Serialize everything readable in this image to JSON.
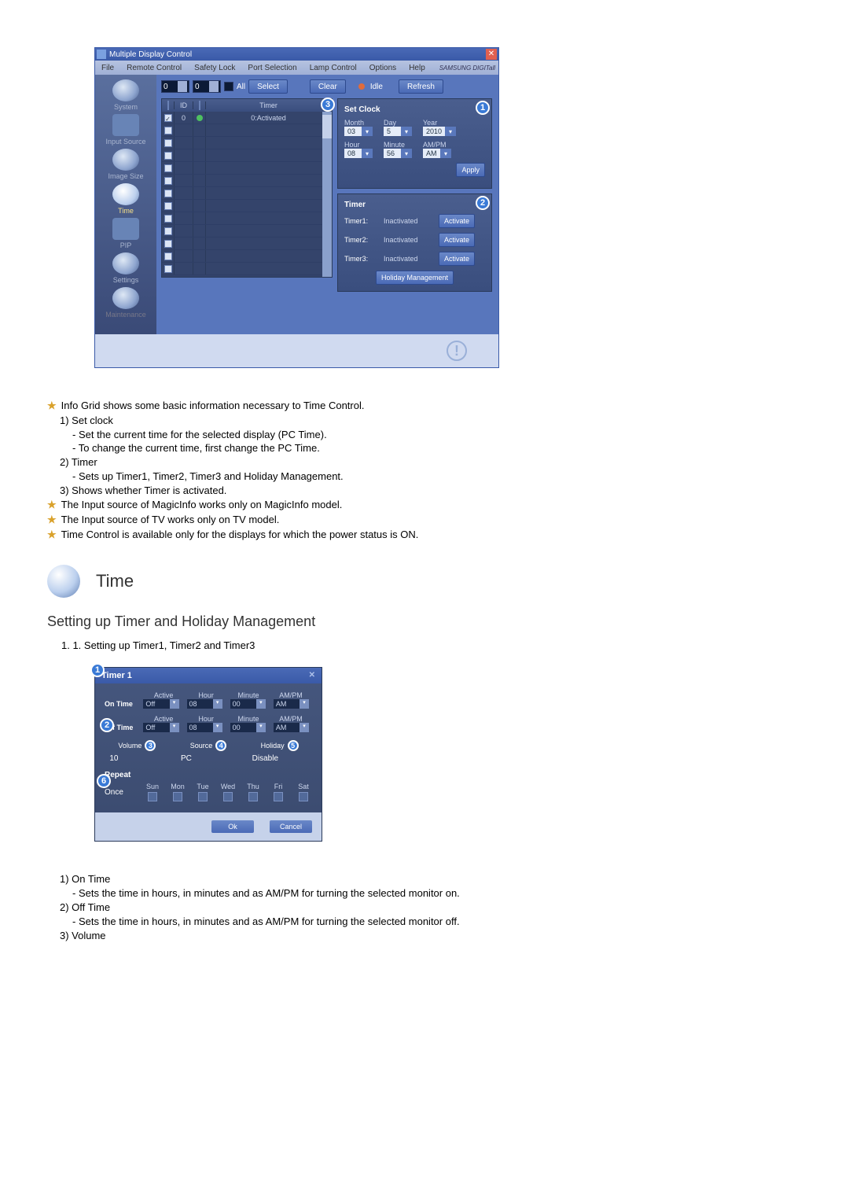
{
  "mdc": {
    "title": "Multiple Display Control",
    "menu": [
      "File",
      "Remote Control",
      "Safety Lock",
      "Port Selection",
      "Lamp Control",
      "Options",
      "Help"
    ],
    "brand": "SAMSUNG DIGITall",
    "sidebar": [
      {
        "label": "System"
      },
      {
        "label": "Input Source"
      },
      {
        "label": "Image Size"
      },
      {
        "label": "Time"
      },
      {
        "label": "PIP"
      },
      {
        "label": "Settings"
      },
      {
        "label": "Maintenance"
      }
    ],
    "toolbar": {
      "spin1": "0",
      "spin2": "0",
      "all": "All",
      "select": "Select",
      "clear": "Clear",
      "idle": "Idle",
      "refresh": "Refresh"
    },
    "grid": {
      "headers": [
        "",
        "ID",
        "",
        "Timer"
      ],
      "row0_id": "0",
      "row0_timer": "0:Activated"
    },
    "setclock": {
      "title": "Set Clock",
      "month_lbl": "Month",
      "month": "03",
      "day_lbl": "Day",
      "day": "5",
      "year_lbl": "Year",
      "year": "2010",
      "hour_lbl": "Hour",
      "hour": "08",
      "minute_lbl": "Minute",
      "minute": "56",
      "ampm_lbl": "AM/PM",
      "ampm": "AM",
      "apply": "Apply"
    },
    "timer_panel": {
      "title": "Timer",
      "rows": [
        {
          "name": "Timer1:",
          "status": "Inactivated",
          "btn": "Activate"
        },
        {
          "name": "Timer2:",
          "status": "Inactivated",
          "btn": "Activate"
        },
        {
          "name": "Timer3:",
          "status": "Inactivated",
          "btn": "Activate"
        }
      ],
      "holiday": "Holiday Management"
    }
  },
  "body": {
    "l1": "Info Grid shows some basic information necessary to Time Control.",
    "n1": "1)  Set clock",
    "s1a": "- Set the current time for the selected display (PC Time).",
    "s1b": "- To change the current time, first change the PC Time.",
    "n2": "2)  Timer",
    "s2a": "- Sets up Timer1, Timer2, Timer3 and Holiday Management.",
    "n3": "3)  Shows whether Timer is activated.",
    "l4": "The Input source of MagicInfo works only on MagicInfo model.",
    "l5": "The Input source of TV works only on TV model.",
    "l6": "Time Control is available only for the displays for which the power status is ON.",
    "time_title": "Time",
    "subtitle": "Setting up Timer and Holiday Management",
    "step": "1.  1. Setting up Timer1, Timer2 and Timer3"
  },
  "timer_dialog": {
    "title": "Timer 1",
    "hdr_active": "Active",
    "hdr_hour": "Hour",
    "hdr_minute": "Minute",
    "hdr_ampm": "AM/PM",
    "on_time": "On Time",
    "off_time": "Off Time",
    "active_val": "Off",
    "hour_val": "08",
    "min_val": "00",
    "ampm_val": "AM",
    "volume": "Volume",
    "volume_val": "10",
    "source": "Source",
    "source_val": "PC",
    "holiday": "Holiday",
    "holiday_val": "Disable",
    "repeat": "Repeat",
    "repeat_val": "Once",
    "days": [
      "Sun",
      "Mon",
      "Tue",
      "Wed",
      "Thu",
      "Fri",
      "Sat"
    ],
    "ok": "Ok",
    "cancel": "Cancel"
  },
  "body2": {
    "n1": "1)  On Time",
    "s1": "- Sets the time in hours, in minutes and as AM/PM for turning the selected monitor on.",
    "n2": "2)  Off Time",
    "s2": "- Sets the time in hours, in minutes and as AM/PM for turning the selected monitor off.",
    "n3": "3)  Volume"
  }
}
